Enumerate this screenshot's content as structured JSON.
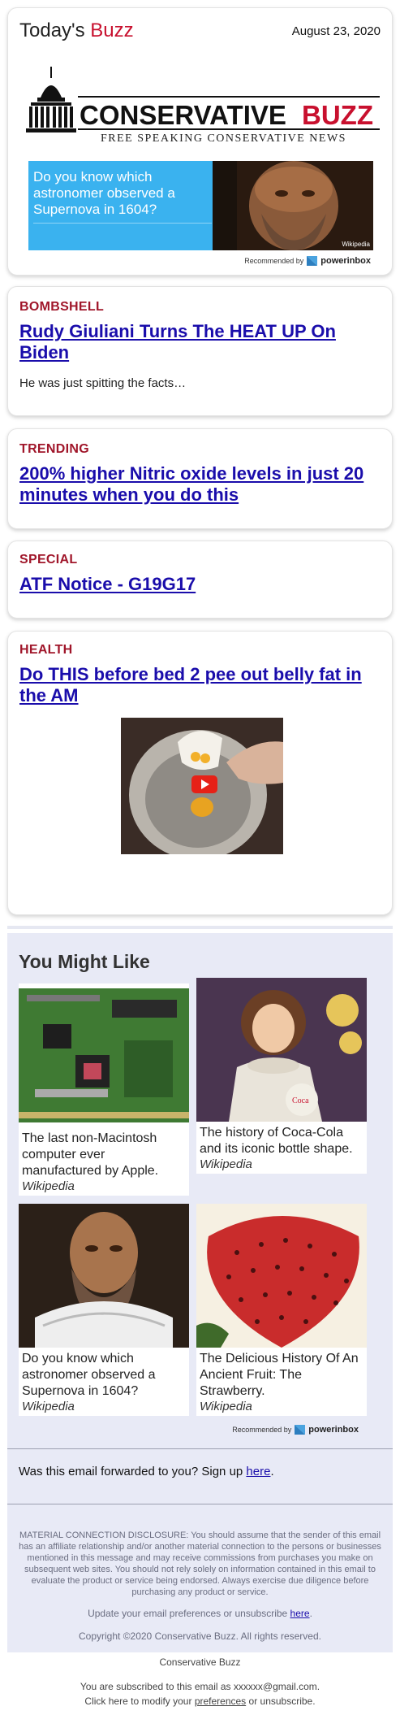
{
  "header": {
    "title_prefix": "Today's ",
    "title_accent": "Buzz",
    "date": "August 23, 2020",
    "logo_main": "CONSERVATIVE",
    "logo_accent": "BUZZ",
    "logo_tagline": "FREE SPEAKING CONSERVATIVE NEWS"
  },
  "top_ad": {
    "text": "Do you know which astronomer observed a Supernova in 1604?",
    "caption": "Wikipedia",
    "recommended_by": "Recommended by",
    "brand": "powerinbox"
  },
  "articles": [
    {
      "category": "BOMBSHELL",
      "headline": "Rudy Giuliani Turns The HEAT UP On Biden",
      "teaser": "He was just spitting the facts…"
    },
    {
      "category": "TRENDING",
      "headline": "200% higher Nitric oxide levels in just 20 minutes when you do this"
    },
    {
      "category": "SPECIAL",
      "headline": "ATF Notice - G19G17"
    },
    {
      "category": "HEALTH",
      "headline": "Do THIS before bed 2 pee out belly fat in the AM"
    }
  ],
  "you_might_like": {
    "title": "You Might Like",
    "items": [
      {
        "text": "The last non-Macintosh computer ever manufactured by Apple.",
        "source": "Wikipedia"
      },
      {
        "text": "The history of Coca-Cola and its iconic bottle shape.",
        "source": "Wikipedia"
      },
      {
        "text": "Do you know which astronomer observed a Supernova in 1604?",
        "source": "Wikipedia"
      },
      {
        "text": "The Delicious History Of An Ancient Fruit: The Strawberry.",
        "source": "Wikipedia"
      }
    ],
    "recommended_by": "Recommended by",
    "brand": "powerinbox"
  },
  "forward": {
    "text": "Was this email forwarded to you? Sign up ",
    "link": "here",
    "end": "."
  },
  "disclosure": "MATERIAL CONNECTION DISCLOSURE: You should assume that the sender of this email has an affiliate relationship and/or another material connection to the persons or businesses mentioned in this message and may receive commissions from purchases you make on subsequent web sites. You should not rely solely on information contained in this email to evaluate the product or service being endorsed. Always exercise due diligence before purchasing any product or service.",
  "prefs": {
    "text": "Update your email preferences or unsubscribe ",
    "link": "here",
    "end": "."
  },
  "copyright": "Copyright ©2020 Conservative Buzz. All rights reserved.",
  "footer": {
    "brand": "Conservative Buzz",
    "subscribed": "You are subscribed to this email as xxxxxx@gmail.com.",
    "modify_prefix": "Click here to modify your ",
    "modify_link": "preferences",
    "modify_suffix": " or unsubscribe."
  },
  "colors": {
    "accent": "#c8102e",
    "link": "#1a0dab",
    "ad_blue": "#3ab2ef",
    "panel": "#e8eaf6"
  }
}
